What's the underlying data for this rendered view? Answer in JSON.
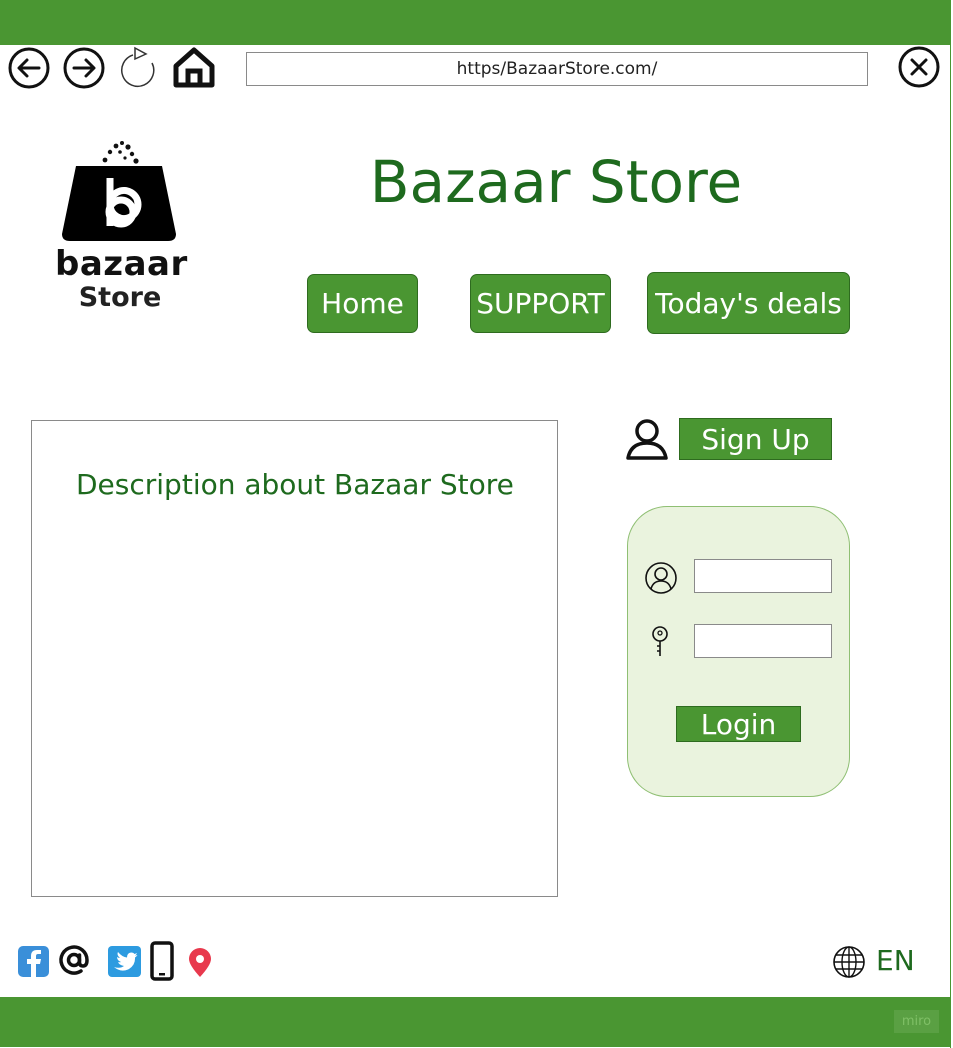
{
  "browser": {
    "url": "https/BazaarStore.com/",
    "icons": [
      "back-arrow-icon",
      "forward-arrow-icon",
      "reload-icon",
      "home-icon",
      "close-icon"
    ]
  },
  "logo": {
    "line1": "bazaar",
    "line2": "Store",
    "icon": "shopping-bag-icon"
  },
  "header": {
    "title": "Bazaar Store"
  },
  "nav": {
    "home": "Home",
    "support": "SUPPORT",
    "deals": "Today's deals"
  },
  "main": {
    "description": "Description about Bazaar Store"
  },
  "auth": {
    "signup_label": "Sign Up",
    "login_label": "Login",
    "username_value": "",
    "password_value": ""
  },
  "footer": {
    "social_icons": [
      "facebook-icon",
      "email-at-icon",
      "twitter-icon",
      "phone-icon",
      "location-pin-icon"
    ],
    "language": "EN",
    "watermark": "miro"
  },
  "colors": {
    "brand_green": "#4a9632",
    "title_green": "#1e6a1e",
    "card_bg": "#eaf3de"
  }
}
